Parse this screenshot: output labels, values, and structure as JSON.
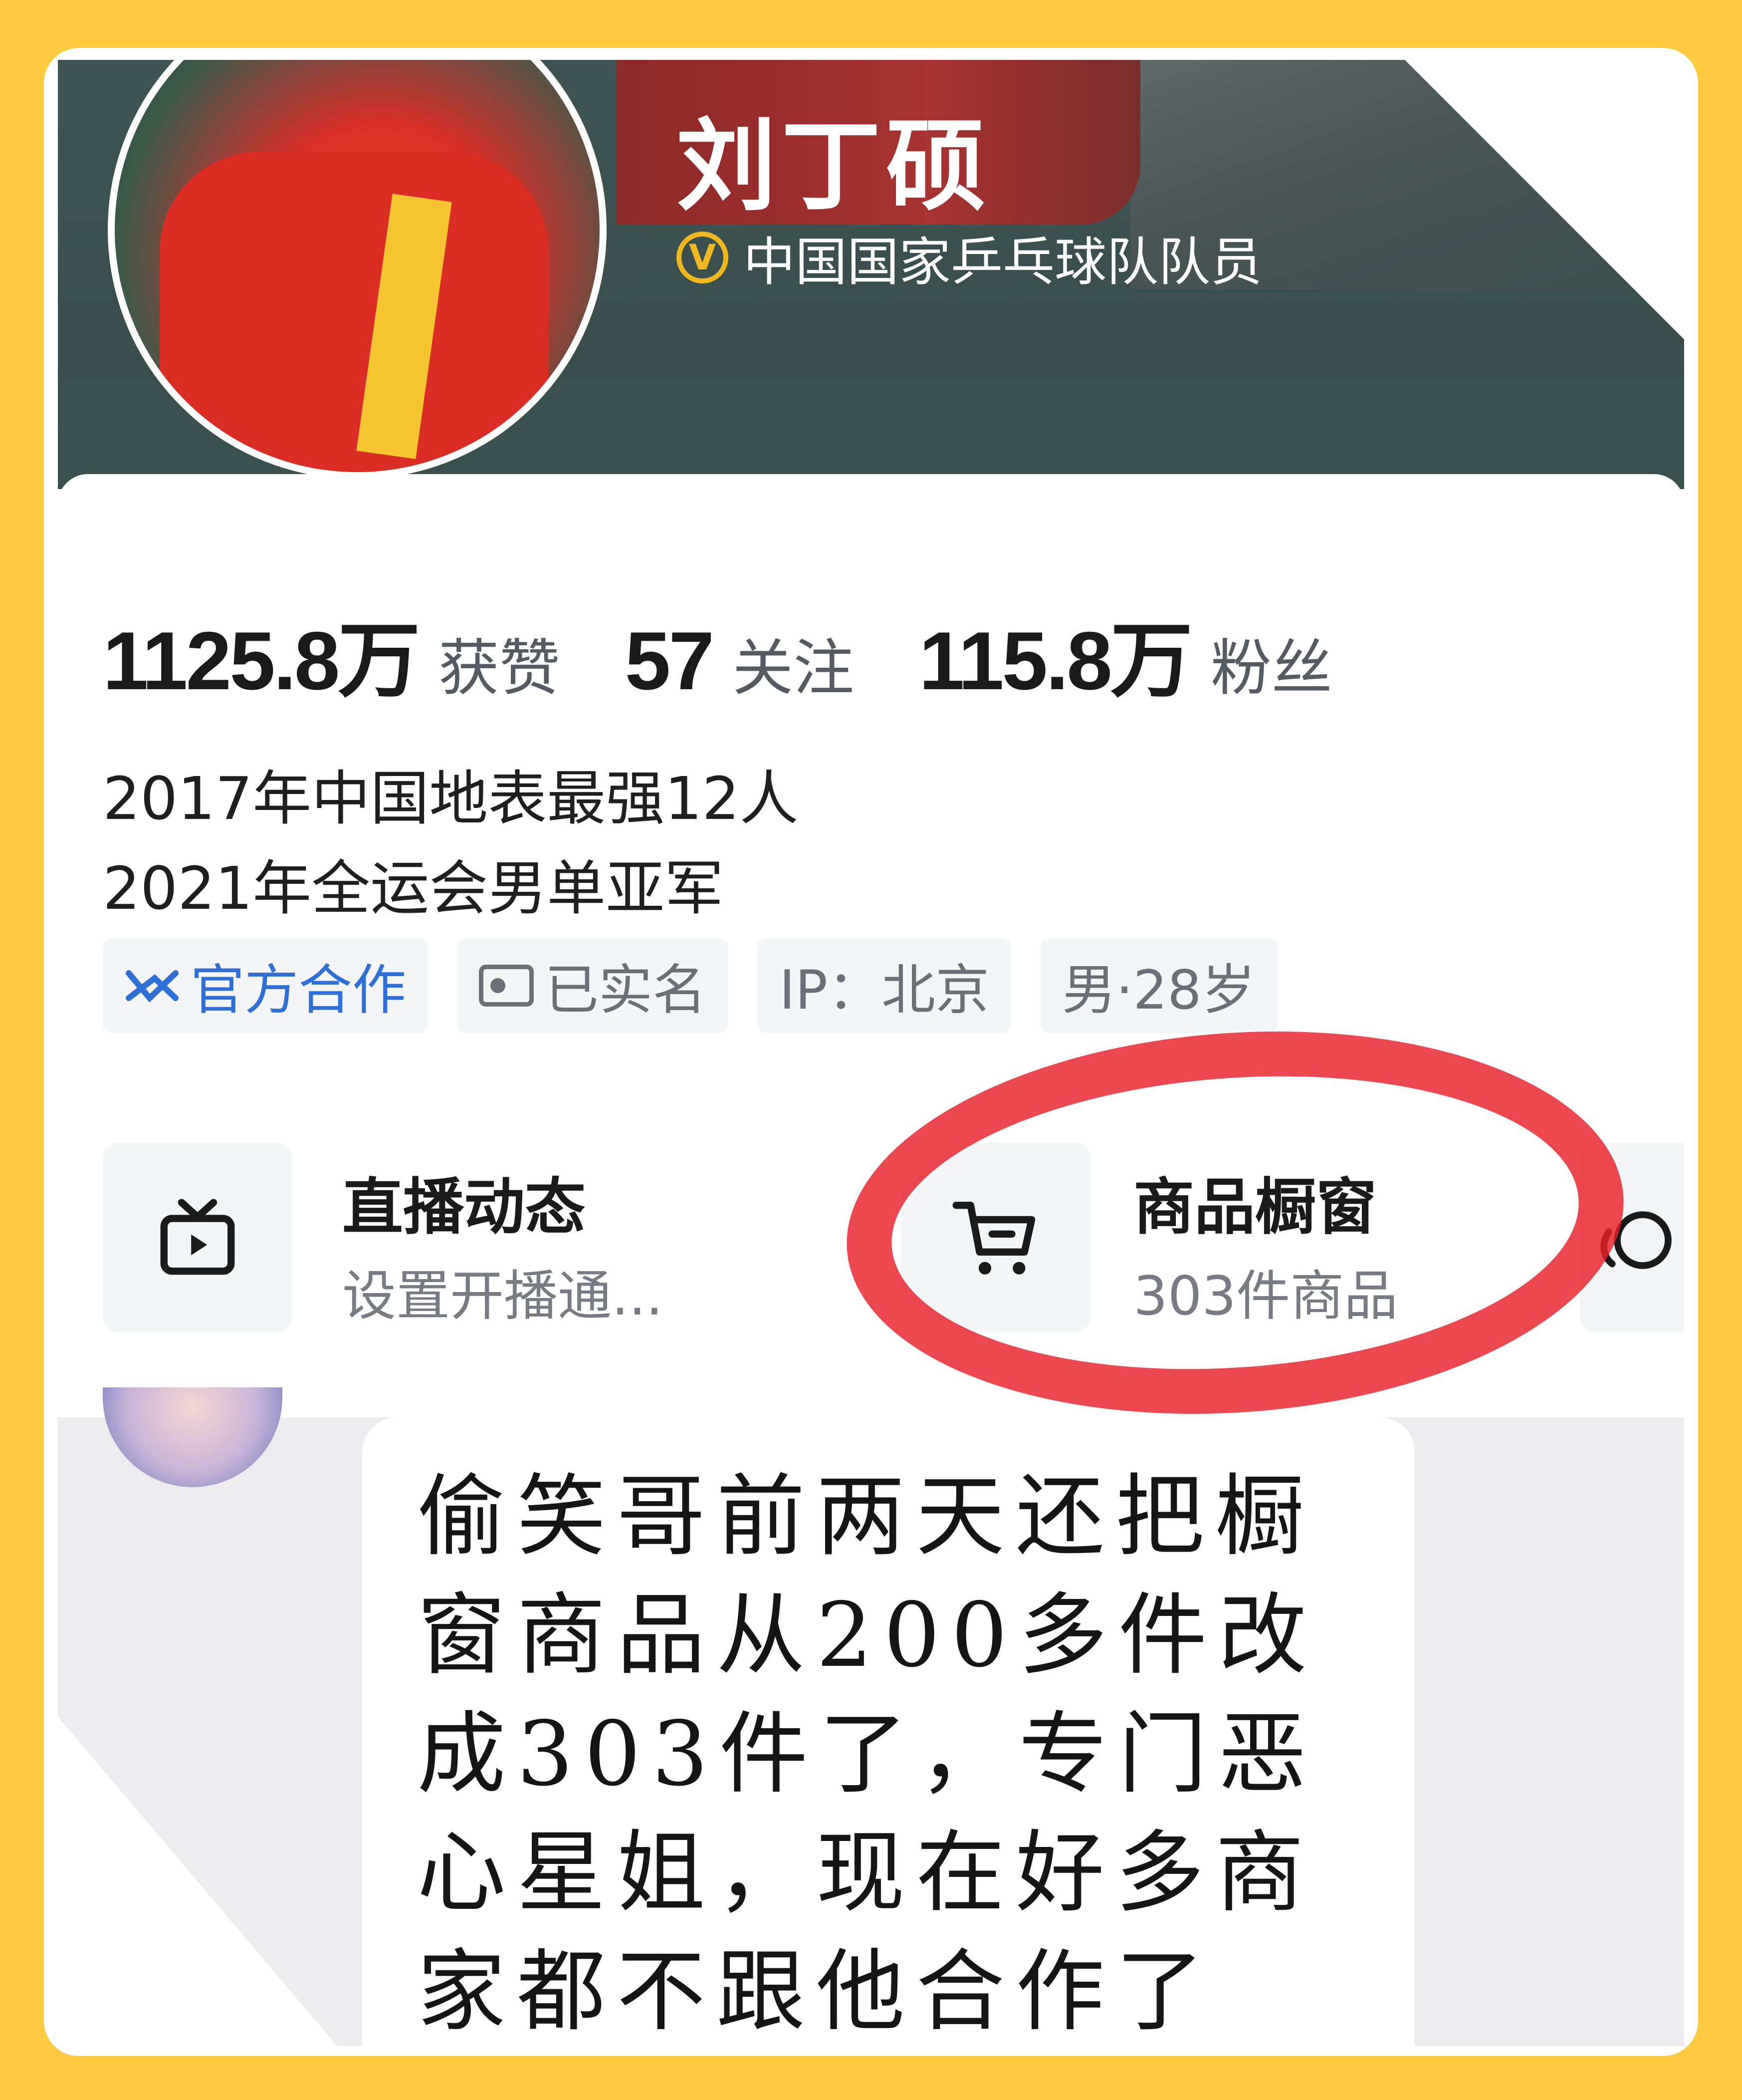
{
  "profile": {
    "name": "刘丁硕",
    "verified_badge": "V",
    "verification": "中国国家乒乓球队队员"
  },
  "stats": [
    {
      "value": "1125.8万",
      "label": "获赞"
    },
    {
      "value": "57",
      "label": "关注"
    },
    {
      "value": "115.8万",
      "label": "粉丝"
    }
  ],
  "bio": {
    "line1": "2017年中国地表最强12人",
    "line2": "2021年全运会男单亚军"
  },
  "tags": {
    "official": "官方合作",
    "realname": "已实名",
    "ip": "IP：北京",
    "gender_age": "男·28岁"
  },
  "tiles": {
    "live": {
      "title": "直播动态",
      "subtitle": "设置开播通..."
    },
    "shop": {
      "title": "商品橱窗",
      "subtitle": "303件商品"
    }
  },
  "comment": {
    "text": "偷笑哥前两天还把橱窗商品从200多件改成303件了，专门恶心星姐，现在好多商家都不跟他合作了"
  },
  "colors": {
    "frame": "#ffc940",
    "banner": "#3e5553",
    "verify_gold": "#f2b61f",
    "official_blue": "#2f6fd8",
    "annotation_red": "#e62028"
  },
  "icons": [
    "heart-icon",
    "verified-icon",
    "official-cooperation-icon",
    "id-card-icon",
    "tv-icon",
    "shopping-cart-icon",
    "chat-icon"
  ]
}
